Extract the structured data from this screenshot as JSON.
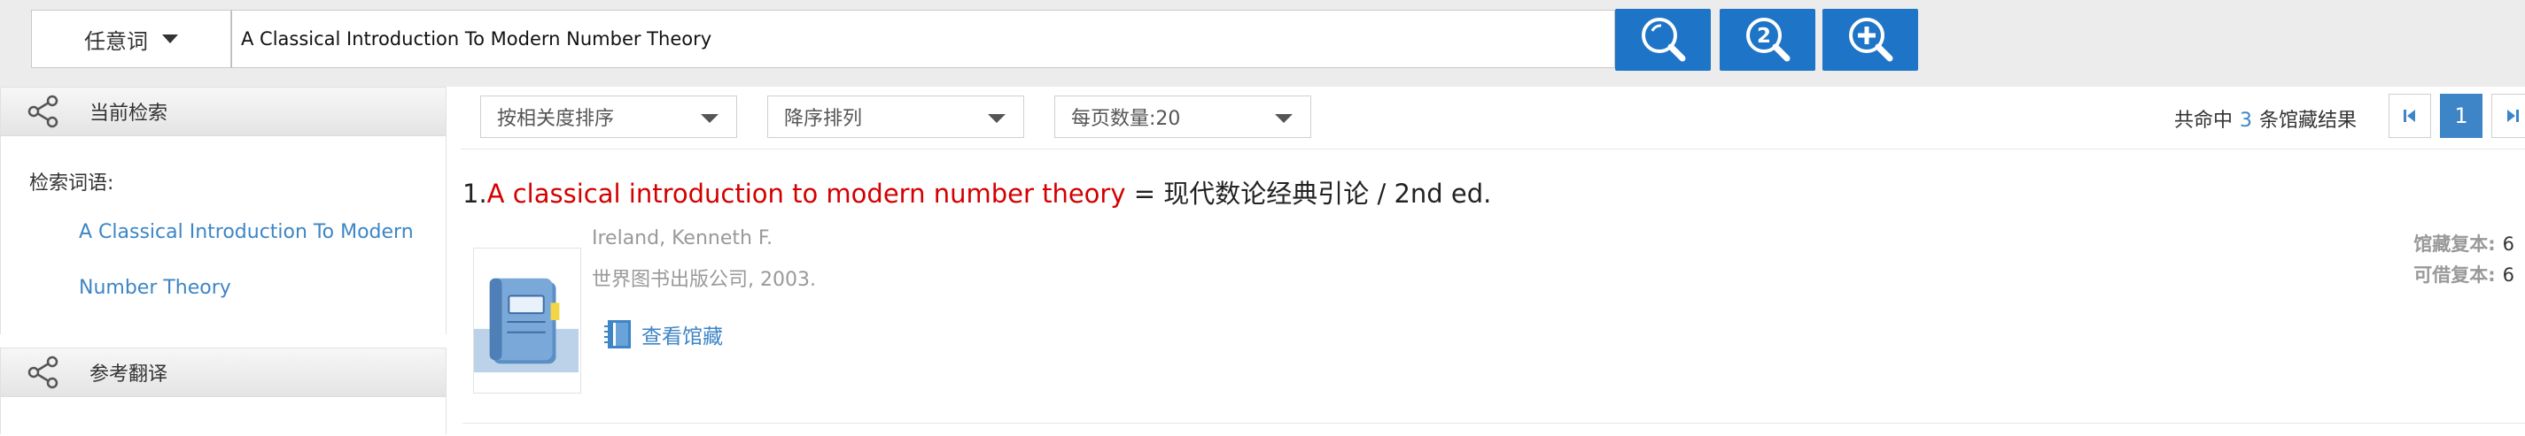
{
  "search": {
    "field_label": "任意词",
    "query": "A Classical Introduction To Modern Number Theory"
  },
  "search_buttons": [
    "search-icon",
    "secondary-search-icon",
    "advanced-search-icon"
  ],
  "sidebar": {
    "current_search_title": "当前检索",
    "keyword_label": "检索词语:",
    "keyword_line1": "A Classical Introduction To Modern",
    "keyword_line2": "Number Theory",
    "translation_title": "参考翻译"
  },
  "toolbar": {
    "sort_by": "按相关度排序",
    "order": "降序排列",
    "page_size": "每页数量:20",
    "total_prefix": "共命中",
    "total_count": "3",
    "total_suffix": "条馆藏结果",
    "current_page": "1"
  },
  "results": [
    {
      "index": "1.",
      "title_highlight": "A classical introduction to modern number theory",
      "title_rest": " = 现代数论经典引论 / 2nd ed.",
      "author": "Ireland, Kenneth F.",
      "publisher": "世界图书出版公司, 2003.",
      "holdings_link": "查看馆藏",
      "copies_label": "馆藏复本:",
      "copies_value": "6",
      "available_label": "可借复本:",
      "available_value": "6"
    }
  ],
  "colors": {
    "accent": "#1e74c7",
    "link": "#3d85c6",
    "highlight": "#d40000"
  }
}
